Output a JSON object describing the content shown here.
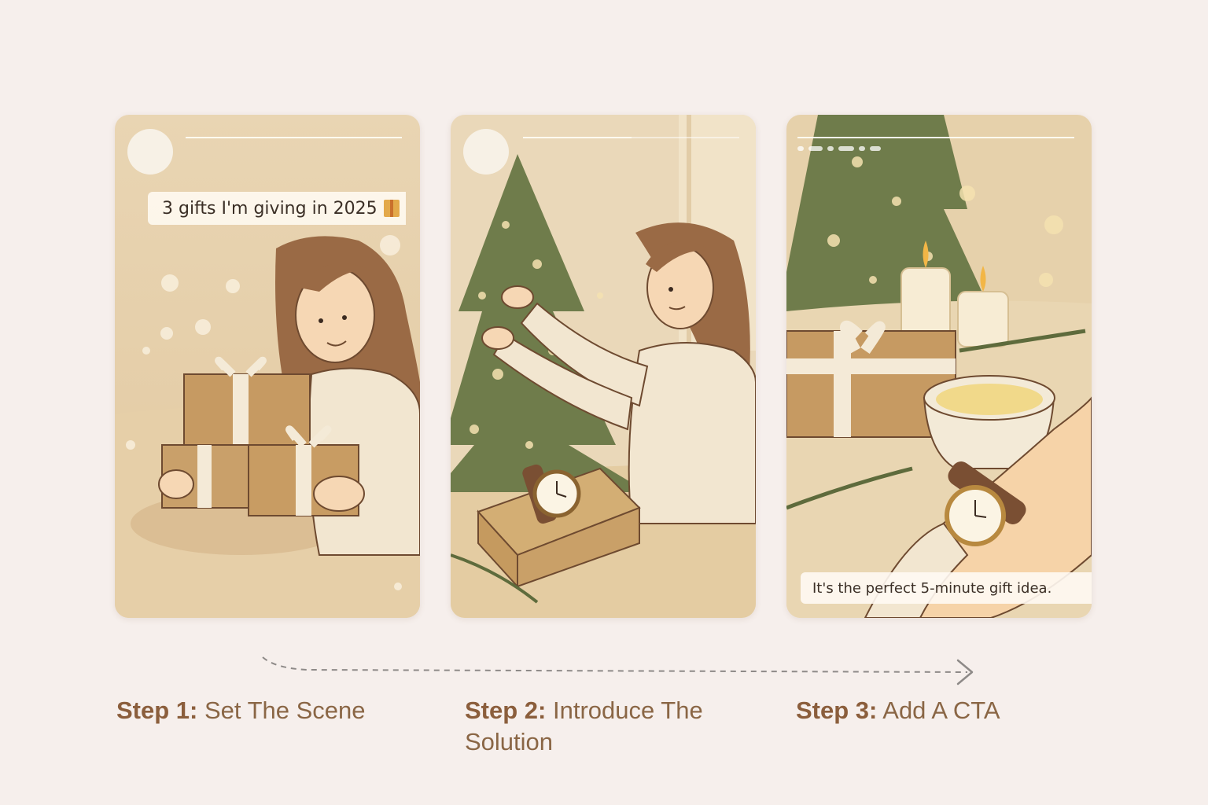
{
  "stories": [
    {
      "caption": "3 gifts I'm giving in 2025",
      "caption_icon": "gift-emoji"
    },
    {
      "caption": ""
    },
    {
      "caption": "It's the perfect 5-minute gift idea."
    }
  ],
  "steps": [
    {
      "label": "Step 1:",
      "text": "Set The Scene"
    },
    {
      "label": "Step 2:",
      "text": "Introduce The Solution"
    },
    {
      "label": "Step 3:",
      "text": "Add A CTA"
    }
  ],
  "colors": {
    "background": "#f6efec",
    "step_label": "#8b5e3c",
    "step_text": "#8a6645",
    "scene_beige": "#e8d3b0"
  }
}
